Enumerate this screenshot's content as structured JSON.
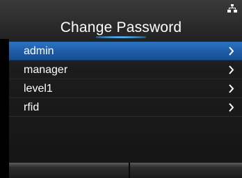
{
  "screen": {
    "title": "Change Password",
    "status_icon": "network-icon"
  },
  "list": {
    "selected_index": 0,
    "items": [
      {
        "label": "admin",
        "icon": "chevron-right-icon"
      },
      {
        "label": "manager",
        "icon": "chevron-right-icon"
      },
      {
        "label": "level1",
        "icon": "chevron-right-icon"
      },
      {
        "label": "rfid",
        "icon": "chevron-right-icon"
      }
    ]
  },
  "softkeys": {
    "left_label": "",
    "right_label": ""
  },
  "colors": {
    "selection": "#1f5da8",
    "accent_underline": "#2f8fd6",
    "text": "#ffffff"
  }
}
